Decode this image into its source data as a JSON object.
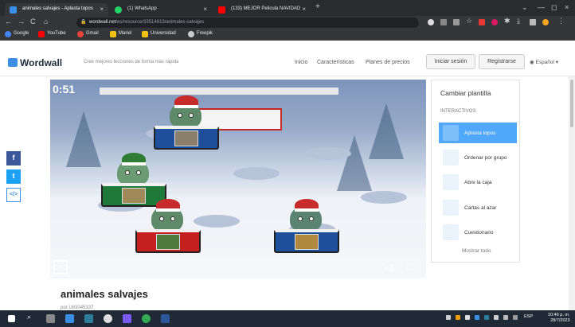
{
  "browser": {
    "tabs": [
      {
        "title": "animales salvajes - Aplasta topos",
        "active": true
      },
      {
        "title": "(1) WhatsApp",
        "active": false
      },
      {
        "title": "(133) MEJOR Pelicula NAVIDAD",
        "active": false
      }
    ],
    "new_tab": "+",
    "url_host": "wordwall.net",
    "url_path": "/es/resource/33514613/animales-salvajes",
    "bookmarks": [
      "Google",
      "YouTube",
      "Gmail",
      "Mariel",
      "Universidad",
      "Freepik"
    ]
  },
  "site": {
    "logo": "Wordwall",
    "tagline": "Cree mejores lecciones de forma más rápida",
    "nav": [
      "Inicio",
      "Características",
      "Planes de precios"
    ],
    "login_label": "Iniciar sesión",
    "register_label": "Registrarse",
    "language": "Español"
  },
  "game": {
    "timer": "0:51"
  },
  "panel": {
    "title": "Cambiar plantilla",
    "subtitle": "INTERACTIVOS",
    "templates": [
      {
        "label": "Aplasta topos",
        "selected": true
      },
      {
        "label": "Ordenar por grupo",
        "selected": false
      },
      {
        "label": "Abre la caja",
        "selected": false
      },
      {
        "label": "Cartas al azar",
        "selected": false
      },
      {
        "label": "Cuestionario",
        "selected": false
      }
    ],
    "more_label": "Mostrar todo"
  },
  "activity": {
    "title": "animales salvajes",
    "author_prefix": "por",
    "author": "U83045337"
  },
  "taskbar": {
    "lang": "ESP",
    "time": "10:46 p. m.",
    "date": "28/7/2023"
  },
  "colors": {
    "accent": "#51a7f9",
    "mole_cards": [
      "#1e4f9b",
      "#1f7a3a",
      "#c42020",
      "#1e4f9b"
    ]
  }
}
